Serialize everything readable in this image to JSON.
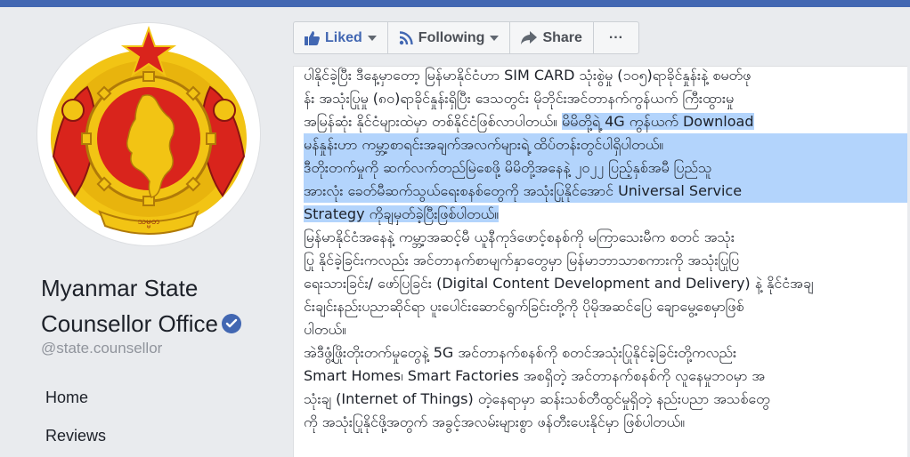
{
  "page": {
    "name_line1": "Myanmar State",
    "name_line2": "Counsellor Office",
    "handle": "@state.counsellor",
    "verified_icon": "verified-badge-icon"
  },
  "nav": {
    "home": "Home",
    "reviews": "Reviews"
  },
  "actions": {
    "liked": "Liked",
    "following": "Following",
    "share": "Share",
    "more": "···"
  },
  "colors": {
    "brand": "#4267b2",
    "highlight": "#b3d4fc",
    "crest_red": "#d9241c",
    "crest_gold": "#f2c414"
  },
  "post": {
    "lines": [
      "ပါနိုင်ခဲ့ပြီး ဒီနေ့မှာတော့ မြန်မာနိုင်ငံဟာ SIM CARD သုံးစွဲမှု (၁၀၅)ရာခိုင်နှုန်းနဲ့ စမတ်ဖု",
      "န်း အသုံးပြုမှု (၈၀)ရာခိုင်နှုန်းရှိပြီး ဒေသတွင်း မိုဘိုင်းအင်တာနက်ကွန်ယက် ကြီးထွားမှု",
      "အမြန်ဆုံး နိုင်ငံများထဲမှာ တစ်နိုင်ငံဖြစ်လာပါတယ်။ မိမိတို့ရဲ့ 4G ကွန်ယက် Download ",
      "မန်နှုန်းဟာ ကမ္ဘာ့စာရင်းအချက်အလက်များရဲ့ ထိပ်တန်းတွင်ပါရှိပါတယ်။",
      "ဒီတိုးတက်မှုကို ဆက်လက်တည်မြဲစေဖို့ မိမိတို့အနေနဲ့ ၂၀၂၂ ပြည့်နှစ်အမီ ပြည်သူ",
      "အားလုံး ခေတ်မီဆက်သွယ်ရေးစနစ်တွေကို အသုံးပြုနိုင်အောင် Universal Service",
      "Strategy ကိုချမှတ်ခဲ့ပြီးဖြစ်ပါတယ်။",
      "မြန်မာနိုင်ငံအနေနဲ့ ကမ္ဘာ့အဆင့်မီ ယူနီကုဒ်ဖောင့်စနစ်ကို မကြာသေးမီက စတင် အသုံး",
      "ပြု နိုင်ခဲ့ခြင်းကလည်း အင်တာနက်စာမျက်နှာတွေမှာ မြန်မာဘာသာစကားကို အသုံးပြုပြ",
      "ရေးသားခြင်း/ ဖော်ပြခြင်း (Digital Content Development and Delivery) နဲ့ နိုင်ငံအချ",
      "င်းချင်းနည်းပညာဆိုင်ရာ ပူးပေါင်းဆောင်ရွက်ခြင်းတို့ကို ပိုမိုအဆင်ပြေ ချောမွေ့စေမှာဖြစ်",
      "ပါတယ်။",
      "အဲဒီဖွံ့ဖြိုးတိုးတက်မှုတွေနဲ့ 5G အင်တာနက်စနစ်ကို စတင်အသုံးပြုနိုင်ခဲ့ခြင်းတို့ကလည်း",
      "Smart Homes၊ Smart Factories အစရှိတဲ့ အင်တာနက်စနစ်ကို လူနေမှုဘဝမှာ အ",
      "သုံးချ (Internet of Things) တဲ့နေရာမှာ ဆန်းသစ်တီထွင်မှုရှိတဲ့ နည်းပညာ အသစ်တွေ",
      "ကို အသုံးပြုနိုင်ဖို့အတွက် အခွင့်အလမ်းများစွာ ဖန်တီးပေးနိုင်မှာ ဖြစ်ပါတယ်။"
    ]
  }
}
